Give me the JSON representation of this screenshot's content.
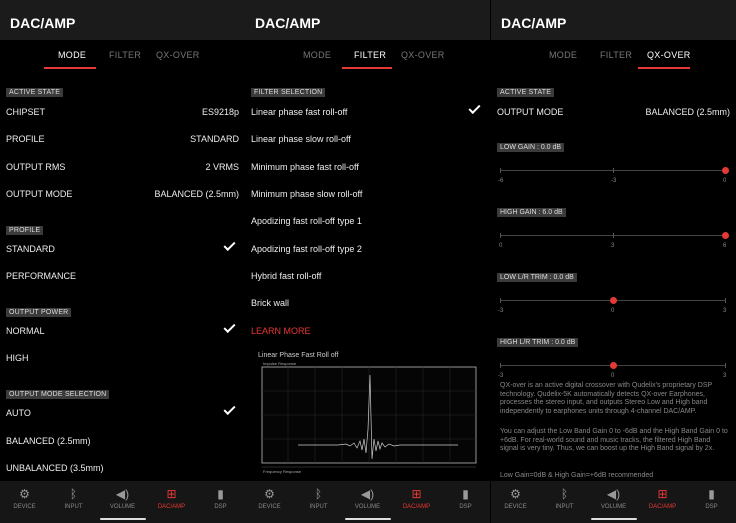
{
  "app_title": "DAC/AMP",
  "tabs": [
    "MODE",
    "FILTER",
    "QX-OVER"
  ],
  "mode": {
    "active_state": "ACTIVE STATE",
    "chipset_label": "CHIPSET",
    "chipset_value": "ES9218p",
    "profile_label": "PROFILE",
    "profile_value": "STANDARD",
    "rms_label": "OUTPUT RMS",
    "rms_value": "2 VRMS",
    "outmode_label": "OUTPUT MODE",
    "outmode_value": "BALANCED (2.5mm)",
    "profile_section": "PROFILE",
    "profile_opts": [
      "STANDARD",
      "PERFORMANCE"
    ],
    "power_section": "OUTPUT POWER",
    "power_opts": [
      "NORMAL",
      "HIGH"
    ],
    "outsel_section": "OUTPUT MODE SELECTION",
    "outsel_opts": [
      "AUTO",
      "BALANCED (2.5mm)",
      "UNBALANCED (3.5mm)"
    ]
  },
  "filter": {
    "section": "FILTER SELECTION",
    "options": [
      "Linear phase fast roll-off",
      "Linear phase slow roll-off",
      "Minimum phase fast roll-off",
      "Minimum phase slow roll-off",
      "Apodizing fast roll-off type 1",
      "Apodizing fast roll-off type 2",
      "Hybrid fast roll-off",
      "Brick wall"
    ],
    "learn_more": "LEARN MORE",
    "chart_title": "Linear Phase Fast Roll off",
    "chart_sub1": "Impulse Response",
    "chart_sub2": "Frequency Response"
  },
  "qx": {
    "active_state": "ACTIVE STATE",
    "outmode_label": "OUTPUT MODE",
    "outmode_value": "BALANCED (2.5mm)",
    "low_gain": "LOW GAIN : 0.0 dB",
    "low_gain_ticks": [
      "-6",
      "-3",
      "0"
    ],
    "low_gain_value": 0,
    "low_gain_range": [
      -6,
      0
    ],
    "high_gain": "HIGH GAIN : 6.0 dB",
    "high_gain_ticks": [
      "0",
      "3",
      "6"
    ],
    "high_gain_value": 6,
    "high_gain_range": [
      0,
      6
    ],
    "low_trim": "LOW L/R TRIM : 0.0 dB",
    "low_trim_ticks": [
      "-3",
      "0",
      "3"
    ],
    "low_trim_value": 0,
    "low_trim_range": [
      -3,
      3
    ],
    "high_trim": "HIGH L/R TRIM : 0.0 dB",
    "high_trim_ticks": [
      "-3",
      "0",
      "3"
    ],
    "high_trim_value": 0,
    "high_trim_range": [
      -3,
      3
    ],
    "desc1": "QX-over is an active digital crossover with Qudelix's proprietary DSP technology. Qudelix-5K automatically detects QX-over Earphones, processes the stereo input, and outputs Stereo Low and High band independently to earphones units through 4-channel DAC/AMP.",
    "desc2": "You can adjust the Low Band Gain 0 to -6dB and the High Band Gain 0 to +6dB. For real-world sound and music tracks, the filtered High Band signal is very tiny. Thus, we can boost up the High Band signal by 2x.",
    "desc3": "Low Gain=0dB & High Gain=+6dB recommended"
  },
  "nav": [
    "DEVICE",
    "INPUT",
    "VOLUME",
    "DAC/AMP",
    "DSP"
  ],
  "nav_icons": [
    "gear-icon",
    "bluetooth-icon",
    "speaker-icon",
    "chip-icon",
    "bars-icon"
  ],
  "accent": "#e53935"
}
